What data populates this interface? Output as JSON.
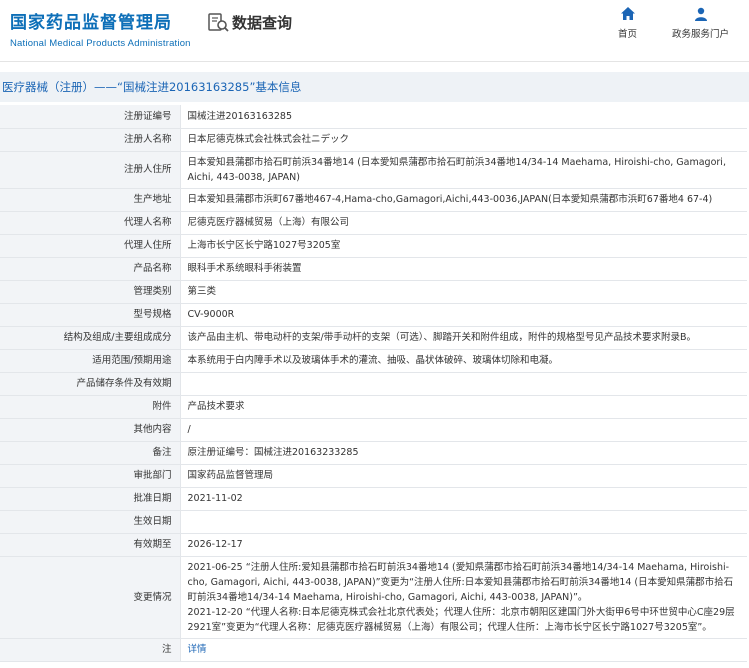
{
  "header": {
    "logo_cn": "国家药品监督管理局",
    "logo_en": "National Medical Products Administration",
    "data_query": "数据查询",
    "nav": [
      {
        "label": "首页",
        "icon": "home-icon"
      },
      {
        "label": "政务服务门户",
        "icon": "user-icon"
      }
    ],
    "accent": "#0d6fb8"
  },
  "title": "医疗器械（注册）——“国械注进20163163285”基本信息",
  "rows": [
    {
      "label": "注册证编号",
      "value": "国械注进20163163285"
    },
    {
      "label": "注册人名称",
      "value": "日本尼德克株式会社株式会社ニデック"
    },
    {
      "label": "注册人住所",
      "value": "日本爱知县蒲郡市拾石町前浜34番地14 (日本愛知県蒲郡市拾石町前浜34番地14/34-14 Maehama, Hiroishi-cho, Gamagori, Aichi, 443-0038, JAPAN)"
    },
    {
      "label": "生产地址",
      "value": "日本爱知县蒲郡市浜町67番地467-4,Hama-cho,Gamagori,Aichi,443-0036,JAPAN(日本愛知県蒲郡市浜町67番地4 67-4)"
    },
    {
      "label": "代理人名称",
      "value": "尼德克医疗器械贸易（上海）有限公司"
    },
    {
      "label": "代理人住所",
      "value": "上海市长宁区长宁路1027号3205室"
    },
    {
      "label": "产品名称",
      "value": "眼科手术系统眼科手術装置"
    },
    {
      "label": "管理类别",
      "value": "第三类"
    },
    {
      "label": "型号规格",
      "value": "CV-9000R"
    },
    {
      "label": "结构及组成/主要组成成分",
      "value": "该产品由主机、带电动杆的支架/带手动杆的支架（可选）、脚踏开关和附件组成，附件的规格型号见产品技术要求附录B。"
    },
    {
      "label": "适用范围/预期用途",
      "value": "本系统用于白内障手术以及玻璃体手术的灌流、抽吸、晶状体破碎、玻璃体切除和电凝。"
    },
    {
      "label": "产品储存条件及有效期",
      "value": ""
    },
    {
      "label": "附件",
      "value": "产品技术要求"
    },
    {
      "label": "其他内容",
      "value": "/"
    },
    {
      "label": "备注",
      "value": "原注册证编号：国械注进20163233285"
    },
    {
      "label": "审批部门",
      "value": "国家药品监督管理局"
    },
    {
      "label": "批准日期",
      "value": "2021-11-02"
    },
    {
      "label": "生效日期",
      "value": ""
    },
    {
      "label": "有效期至",
      "value": "2026-12-17"
    },
    {
      "label": "变更情况",
      "value": "2021-06-25 “注册人住所:爱知县蒲郡市拾石町前浜34番地14 (愛知県蒲郡市拾石町前浜34番地14/34-14 Maehama, Hiroishi-cho, Gamagori, Aichi, 443-0038, JAPAN)”变更为“注册人住所:日本爱知县蒲郡市拾石町前浜34番地14 (日本愛知県蒲郡市拾石町前浜34番地14/34-14 Maehama, Hiroishi-cho, Gamagori, Aichi, 443-0038, JAPAN)”。\n2021-12-20 “代理人名称:日本尼德克株式会社北京代表处；代理人住所：北京市朝阳区建国门外大街甲6号中环世贸中心C座29层2921室”变更为“代理人名称：尼德克医疗器械贸易（上海）有限公司；代理人住所：上海市长宁区长宁路1027号3205室”。"
    },
    {
      "label": "注",
      "value": "详情",
      "link": true
    }
  ]
}
